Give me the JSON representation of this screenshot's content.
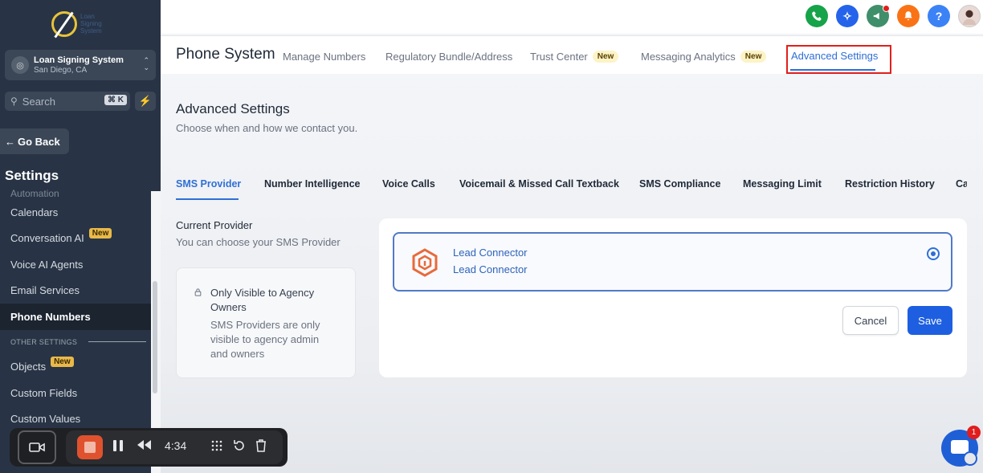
{
  "sidebar": {
    "logo_text": [
      "Loan",
      "Signing",
      "System"
    ],
    "account": {
      "name": "Loan Signing System",
      "location": "San Diego, CA"
    },
    "search": {
      "placeholder": "Search",
      "shortcut": "⌘ K"
    },
    "go_back": "Go Back",
    "title": "Settings",
    "items": [
      {
        "label": "Automation"
      },
      {
        "label": "Calendars"
      },
      {
        "label": "Conversation AI",
        "badge": "New"
      },
      {
        "label": "Voice AI Agents"
      },
      {
        "label": "Email Services"
      },
      {
        "label": "Phone Numbers"
      }
    ],
    "section_label": "OTHER SETTINGS",
    "items2": [
      {
        "label": "Objects",
        "badge": "New"
      },
      {
        "label": "Custom Fields"
      },
      {
        "label": "Custom Values"
      }
    ]
  },
  "topbar": {
    "icons": [
      {
        "name": "phone-icon",
        "color": "#16a34a"
      },
      {
        "name": "sparkle-icon",
        "color": "#2563eb"
      },
      {
        "name": "megaphone-icon",
        "color": "#3f8f6a"
      },
      {
        "name": "bell-icon",
        "color": "#f97316"
      },
      {
        "name": "help-icon",
        "color": "#3b82f6"
      }
    ],
    "help_label": "?"
  },
  "header": {
    "title": "Phone System",
    "tabs": [
      {
        "label": "Manage Numbers"
      },
      {
        "label": "Regulatory Bundle/Address"
      },
      {
        "label": "Trust Center",
        "badge": "New"
      },
      {
        "label": "Messaging Analytics",
        "badge": "New"
      },
      {
        "label": "Advanced Settings",
        "active": true
      }
    ]
  },
  "page": {
    "title": "Advanced Settings",
    "subtitle": "Choose when and how we contact you.",
    "subtabs": [
      "SMS Provider",
      "Number Intelligence",
      "Voice Calls",
      "Voicemail & Missed Call Textback",
      "SMS Compliance",
      "Messaging Limit",
      "Restriction History",
      "Ca"
    ],
    "current_provider": {
      "title": "Current Provider",
      "subtitle": "You can choose your SMS Provider"
    },
    "notice": {
      "title": "Only Visible to Agency Owners",
      "body": "SMS Providers are only visible to agency admin and owners"
    },
    "provider": {
      "name": "Lead Connector",
      "subname": "Lead Connector",
      "selected": true
    },
    "buttons": {
      "cancel": "Cancel",
      "save": "Save"
    }
  },
  "recorder": {
    "time": "4:34"
  },
  "chat": {
    "badge": "1"
  },
  "colors": {
    "accent": "#2f6fd6",
    "sidebar": "#283445",
    "save": "#1d5fe0",
    "highlight_box": "#e0201c"
  }
}
